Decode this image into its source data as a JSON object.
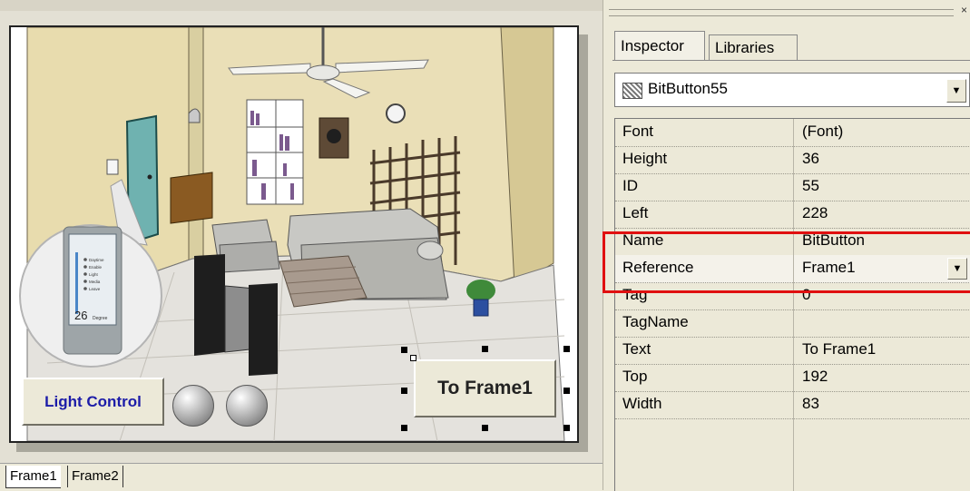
{
  "design": {
    "light_button_label": "Light Control",
    "frame_button_label": "To Frame1",
    "panel_temp": "26",
    "panel_unit": "Degree",
    "panel_items": [
      "Daytime",
      "Enable",
      "Light",
      "Media",
      "Leave"
    ]
  },
  "frame_tabs": [
    "Frame1",
    "Frame2"
  ],
  "inspector": {
    "close_symbol": "×",
    "tabs": [
      "Inspector",
      "Libraries"
    ],
    "selected_component": "BitButton55",
    "properties": [
      {
        "name": "Font",
        "value": "(Font)"
      },
      {
        "name": "Height",
        "value": "36"
      },
      {
        "name": "ID",
        "value": "55"
      },
      {
        "name": "Left",
        "value": "228"
      },
      {
        "name": "Name",
        "value": "BitButton"
      },
      {
        "name": "Reference",
        "value": "Frame1"
      },
      {
        "name": "Tag",
        "value": "0"
      },
      {
        "name": "TagName",
        "value": ""
      },
      {
        "name": "Text",
        "value": "To Frame1"
      },
      {
        "name": "Top",
        "value": "192"
      },
      {
        "name": "Width",
        "value": "83"
      }
    ]
  },
  "colors": {
    "highlight": "#e01010",
    "light_button_text": "#1c1ca8"
  }
}
